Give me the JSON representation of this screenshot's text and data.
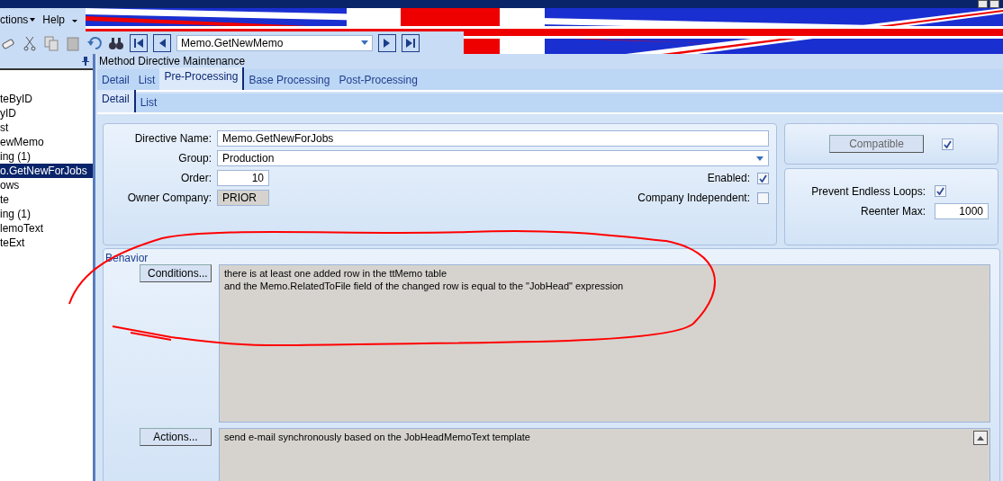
{
  "menu": [
    {
      "label": "ctions",
      "dropdown": true
    },
    {
      "label": "Help",
      "dropdown": false
    }
  ],
  "toolbar": {
    "navigator": {
      "value": "Memo.GetNewMemo"
    }
  },
  "sidebar": {
    "items": [
      {
        "label": "teByID",
        "selected": false
      },
      {
        "label": "yID",
        "selected": false
      },
      {
        "label": "st",
        "selected": false
      },
      {
        "label": "ewMemo",
        "selected": false
      },
      {
        "label": "ing (1)",
        "selected": false
      },
      {
        "label": "o.GetNewForJobs",
        "selected": true
      },
      {
        "label": "ows",
        "selected": false
      },
      {
        "label": "te",
        "selected": false
      },
      {
        "label": "ing (1)",
        "selected": false
      },
      {
        "label": "lemoText",
        "selected": false
      },
      {
        "label": "teExt",
        "selected": false
      }
    ]
  },
  "panel": {
    "title": "Method Directive Maintenance"
  },
  "tabs": [
    {
      "label": "Detail",
      "selected": false
    },
    {
      "label": "List",
      "selected": false
    },
    {
      "label": "Pre-Processing",
      "selected": true
    },
    {
      "label": "Base Processing",
      "selected": false
    },
    {
      "label": "Post-Processing",
      "selected": false
    }
  ],
  "subtabs": [
    {
      "label": "Detail",
      "selected": true
    },
    {
      "label": "List",
      "selected": false
    }
  ],
  "form": {
    "directive_name": {
      "label": "Directive Name:",
      "value": "Memo.GetNewForJobs"
    },
    "group": {
      "label": "Group:",
      "value": "Production"
    },
    "order": {
      "label": "Order:",
      "value": "10"
    },
    "owner_company": {
      "label": "Owner Company:",
      "value": "PRIOR",
      "disabled": true
    },
    "enabled": {
      "label": "Enabled:",
      "checked": true
    },
    "company_independent": {
      "label": "Company Independent:",
      "checked": false
    }
  },
  "compatible": {
    "label": "Compatible",
    "checked": true
  },
  "loops": {
    "prevent": {
      "label": "Prevent Endless Loops:",
      "checked": true
    },
    "reenter_max": {
      "label": "Reenter Max:",
      "value": "1000"
    }
  },
  "behavior": {
    "title": "Behavior",
    "conditions": {
      "button": "Conditions...",
      "lines": [
        "there is at least one added row in the ttMemo table",
        "and the Memo.RelatedToFile field of the changed row is equal to the \"JobHead\" expression"
      ]
    },
    "actions": {
      "button": "Actions...",
      "lines": [
        "send e-mail synchronously based on the JobHeadMemoText template"
      ]
    }
  }
}
